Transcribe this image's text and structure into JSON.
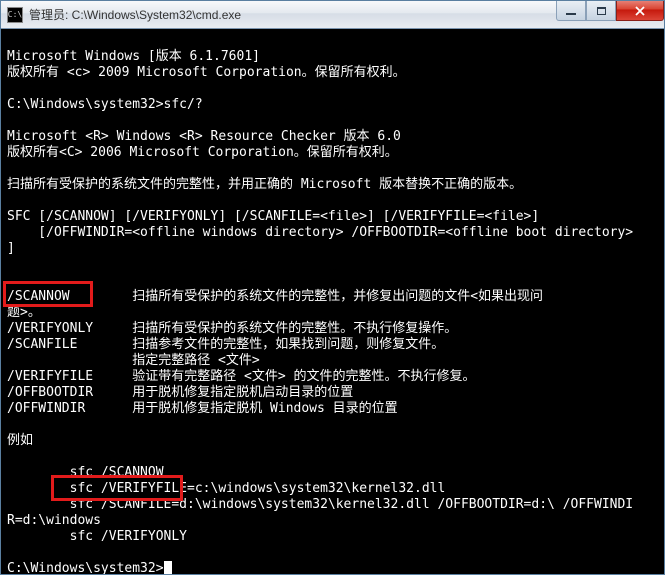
{
  "title": "管理员: C:\\Windows\\System32\\cmd.exe",
  "window_controls": {
    "minimize": "minimize",
    "maximize": "maximize",
    "close": "close"
  },
  "lines": {
    "l0": "Microsoft Windows [版本 6.1.7601]",
    "l1": "版权所有 <c> 2009 Microsoft Corporation。保留所有权利。",
    "l2": "",
    "l3": "C:\\Windows\\system32>sfc/?",
    "l4": "",
    "l5": "Microsoft <R> Windows <R> Resource Checker 版本 6.0",
    "l6": "版权所有<C> 2006 Microsoft Corporation。保留所有权利。",
    "l7": "",
    "l8": "扫描所有受保护的系统文件的完整性，并用正确的 Microsoft 版本替换不正确的版本。",
    "l9": "",
    "l10": "SFC [/SCANNOW] [/VERIFYONLY] [/SCANFILE=<file>] [/VERIFYFILE=<file>]",
    "l11": "    [/OFFWINDIR=<offline windows directory> /OFFBOOTDIR=<offline boot directory>",
    "l12": "]",
    "l13": "",
    "l14": "",
    "l15": "/SCANNOW        扫描所有受保护的系统文件的完整性，并修复出问题的文件<如果出现问",
    "l16": "题>。",
    "l17": "/VERIFYONLY     扫描所有受保护的系统文件的完整性。不执行修复操作。",
    "l18": "/SCANFILE       扫描参考文件的完整性，如果找到问题，则修复文件。",
    "l19": "                指定完整路径 <文件>",
    "l20": "/VERIFYFILE     验证带有完整路径 <文件> 的文件的完整性。不执行修复。",
    "l21": "/OFFBOOTDIR     用于脱机修复指定脱机启动目录的位置",
    "l22": "/OFFWINDIR      用于脱机修复指定脱机 Windows 目录的位置",
    "l23": "",
    "l24": "例如",
    "l25": "",
    "l26": "        sfc /SCANNOW",
    "l27": "        sfc /VERIFYFILE=c:\\windows\\system32\\kernel32.dll",
    "l28": "        sfc /SCANFILE=d:\\windows\\system32\\kernel32.dll /OFFBOOTDIR=d:\\ /OFFWINDI",
    "l29": "R=d:\\windows",
    "l30": "        sfc /VERIFYONLY",
    "l31": "",
    "l32": "C:\\Windows\\system32>"
  },
  "highlights": {
    "h1": "/SCANNOW",
    "h2": "sfc /SCANNOW"
  }
}
